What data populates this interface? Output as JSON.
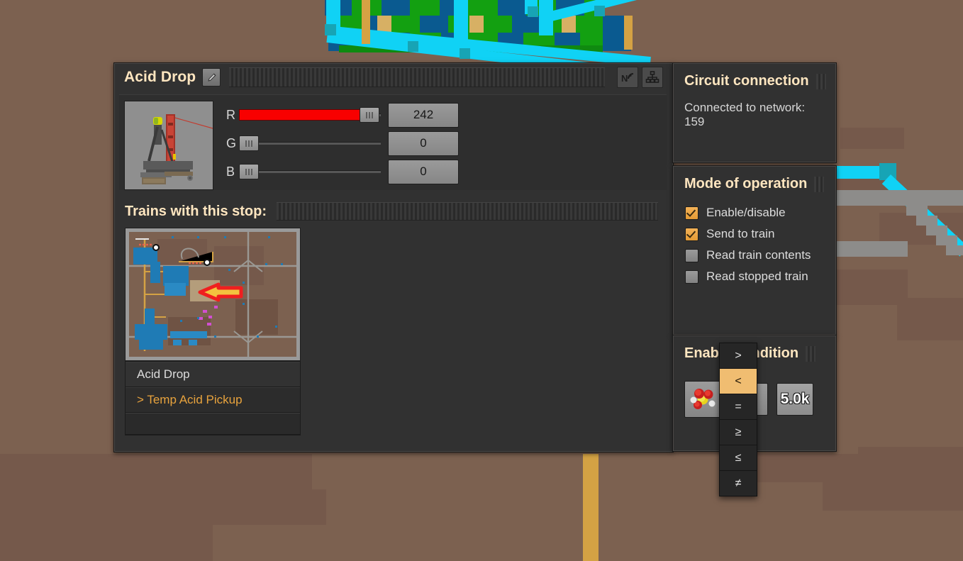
{
  "window": {
    "title": "Acid Drop",
    "edit_icon": "pencil-icon",
    "header_icons": [
      "wireless-network-icon",
      "circuit-network-icon"
    ]
  },
  "color_picker": {
    "channels": [
      {
        "label": "R",
        "value": "242",
        "fill_pct": 95,
        "color": "#f80000"
      },
      {
        "label": "G",
        "value": "0",
        "fill_pct": 0,
        "color": "#00c000"
      },
      {
        "label": "B",
        "value": "0",
        "fill_pct": 0,
        "color": "#2060f0"
      }
    ]
  },
  "trains_section": {
    "title": "Trains with this stop:",
    "schedule": [
      {
        "label": "Acid Drop",
        "state": "current"
      },
      {
        "label": "> Temp Acid Pickup",
        "state": "next"
      },
      {
        "label": "",
        "state": "empty"
      }
    ]
  },
  "circuit_connection": {
    "title": "Circuit connection",
    "status": "Connected to network: 159"
  },
  "mode_of_operation": {
    "title": "Mode of operation",
    "options": [
      {
        "label": "Enable/disable",
        "checked": true
      },
      {
        "label": "Send to train",
        "checked": true
      },
      {
        "label": "Read train contents",
        "checked": false
      },
      {
        "label": "Read stopped train",
        "checked": false
      }
    ]
  },
  "enable_condition": {
    "title": "Enable condition",
    "signal_icon": "sulfuric-acid-icon",
    "comparator_selected": "<",
    "constant_value": "5.0k",
    "comparator_options": [
      ">",
      "<",
      "=",
      "≥",
      "≤",
      "≠"
    ]
  },
  "colors": {
    "panel_bg": "#2e2e2e",
    "title_text": "#ffe6c0",
    "accent_orange": "#e8a33d",
    "terrain": "#7c6150",
    "belt_cyan": "#10d2f5"
  }
}
